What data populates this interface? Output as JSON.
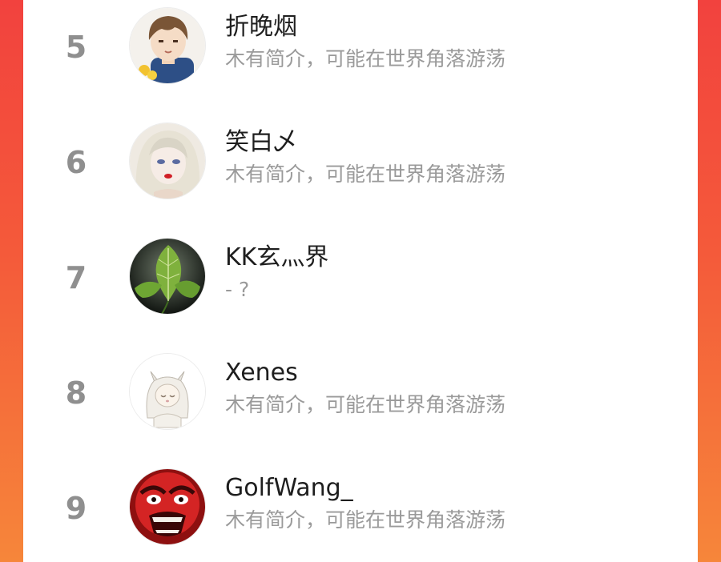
{
  "colors": {
    "background_top": "#f2423e",
    "background_bottom": "#f6863a",
    "rank_text": "#8f8f8f",
    "name_text": "#1e1e1e",
    "bio_text": "#9a9a9a"
  },
  "ranking": {
    "items": [
      {
        "rank": "5",
        "name": "折晚烟",
        "bio": "木有简介，可能在世界角落游荡",
        "avatar_icon": "cartoon-boy-avatar-icon"
      },
      {
        "rank": "6",
        "name": "笑白乄",
        "bio": "木有简介，可能在世界角落游荡",
        "avatar_icon": "anime-girl-avatar-icon"
      },
      {
        "rank": "7",
        "name": "KK玄灬界",
        "bio": "- ?",
        "avatar_icon": "green-leaf-avatar-icon"
      },
      {
        "rank": "8",
        "name": "Xenes",
        "bio": "木有简介，可能在世界角落游荡",
        "avatar_icon": "cat-girl-sketch-avatar-icon"
      },
      {
        "rank": "9",
        "name": "GolfWang_",
        "bio": "木有简介，可能在世界角落游荡",
        "avatar_icon": "red-angry-face-avatar-icon"
      }
    ]
  }
}
